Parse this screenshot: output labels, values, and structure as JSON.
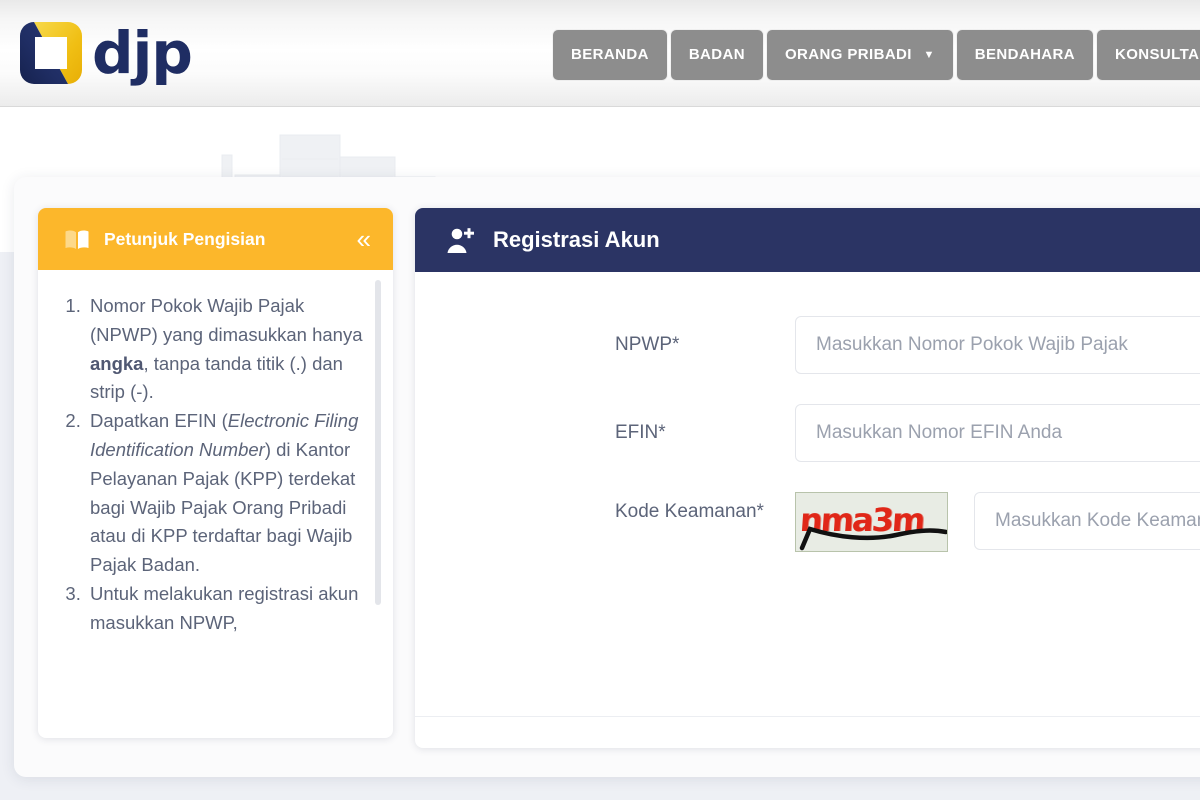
{
  "brand": {
    "logo_text": "djp",
    "logo_colors": {
      "yellow": "#f5c518",
      "navy": "#1f2d63"
    }
  },
  "nav": {
    "items": [
      {
        "label": "BERANDA",
        "has_caret": false
      },
      {
        "label": "BADAN",
        "has_caret": false
      },
      {
        "label": "ORANG PRIBADI",
        "has_caret": true
      },
      {
        "label": "BENDAHARA",
        "has_caret": false
      },
      {
        "label": "KONSULTAN",
        "has_caret": false
      }
    ],
    "caret_glyph": "▼",
    "button_color": "#8d8d8d"
  },
  "sidebar": {
    "title": "Petunjuk Pengisian",
    "icon": "book-icon",
    "collapse_glyph": "«",
    "header_color": "#fcb72b",
    "items": [
      {
        "index": 1,
        "parts": [
          {
            "text": "Nomor Pokok Wajib Pajak (NPWP) yang dimasukkan hanya ",
            "style": "normal"
          },
          {
            "text": "angka",
            "style": "bold"
          },
          {
            "text": ", tanpa tanda titik (.) dan strip (-).",
            "style": "normal"
          }
        ]
      },
      {
        "index": 2,
        "parts": [
          {
            "text": "Dapatkan EFIN (",
            "style": "normal"
          },
          {
            "text": "Electronic Filing Identification Number",
            "style": "italic"
          },
          {
            "text": ") di Kantor Pelayanan Pajak (KPP) terdekat bagi Wajib Pajak Orang Pribadi atau di KPP terdaftar bagi Wajib Pajak Badan.",
            "style": "normal"
          }
        ]
      },
      {
        "index": 3,
        "parts": [
          {
            "text": "Untuk melakukan registrasi akun masukkan NPWP,",
            "style": "normal"
          }
        ]
      }
    ]
  },
  "form": {
    "title": "Registrasi Akun",
    "icon": "user-plus-icon",
    "header_color": "#2b3464",
    "fields": [
      {
        "label": "NPWP*",
        "placeholder": "Masukkan Nomor Pokok Wajib Pajak",
        "value": ""
      },
      {
        "label": "EFIN*",
        "placeholder": "Masukkan Nomor EFIN Anda",
        "value": ""
      }
    ],
    "captcha": {
      "label": "Kode Keamanan*",
      "image_text": "nma3m",
      "image_color": "#e02718",
      "image_background": "#e8ece4",
      "placeholder": "Masukkan Kode Keamanan",
      "value": ""
    }
  }
}
